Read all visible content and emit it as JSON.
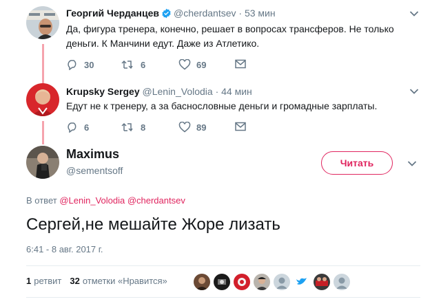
{
  "parent_tweets": [
    {
      "name": "Георгий Черданцев",
      "handle": "@cherdantsev",
      "time": "· 53 мин",
      "verified": true,
      "text_lines": [
        "Да, фигура тренера, конечно, решает в вопросах трансферов. Не только",
        "деньги. К Манчини едут. Даже из Атлетико."
      ],
      "replies": "30",
      "retweets": "6",
      "likes": "69"
    },
    {
      "name": "Krupsky Sergey",
      "handle": "@Lenin_Volodia",
      "time": "· 44 мин",
      "verified": false,
      "text_lines": [
        "Едут не к тренеру, а за баснословные деньги и громадные зарплаты."
      ],
      "replies": "6",
      "retweets": "8",
      "likes": "89"
    }
  ],
  "main_tweet": {
    "name": "Maximus",
    "handle": "@sementsoff",
    "follow_label": "Читать",
    "reply_prefix": "В ответ",
    "reply_mentions": "@Lenin_Volodia @cherdantsev",
    "text": "Сергей,не мешайте Жоре лизать",
    "date": "6:41 - 8 авг. 2017 г.",
    "retweet_count": "1",
    "retweet_label": "ретвит",
    "like_count": "32",
    "like_label": "отметки «Нравится»"
  },
  "colors": {
    "accent": "#e0245e",
    "thread_line": "#f5a3ad",
    "muted_text": "#657786",
    "verified": "#1da1f2"
  },
  "icons": {
    "reply": "reply-icon",
    "retweet": "retweet-icon",
    "like": "heart-icon",
    "message": "envelope-icon",
    "more": "chevron-down-icon",
    "verified": "verified-badge-icon"
  }
}
